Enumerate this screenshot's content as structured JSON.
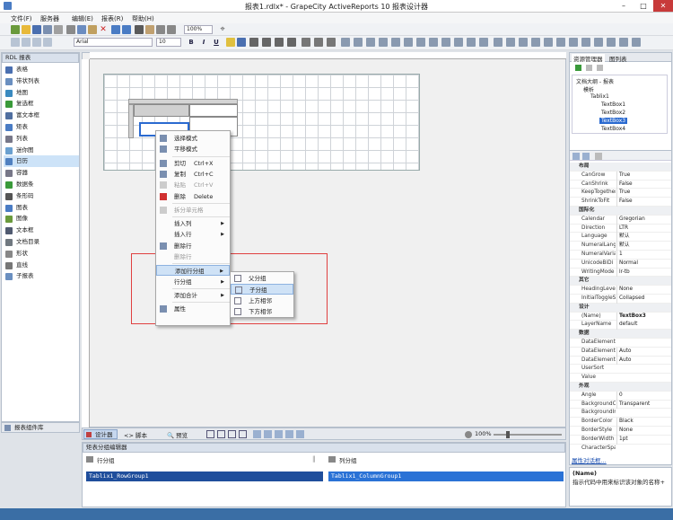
{
  "window": {
    "title": "报表1.rdlx* - GrapeCity ActiveReports 10 报表设计器",
    "minimize": "–",
    "maximize": "□",
    "close": "✕"
  },
  "menu": [
    "文件(F)",
    "服务器",
    "编辑(E)",
    "报表(R)",
    "帮助(H)"
  ],
  "toolbar": {
    "zoom": "100%",
    "font_name": "Arial",
    "font_size": "10",
    "bold": "B",
    "italic": "I",
    "underline": "U"
  },
  "toolbox": {
    "title": "RDL 报表",
    "items": [
      "表格",
      "带状列表",
      "地图",
      "复选框",
      "富文本框",
      "矩表",
      "列表",
      "迷你图",
      "日历",
      "容器",
      "数据条",
      "条形码",
      "图表",
      "图像",
      "文本框",
      "文档目录",
      "形状",
      "直线",
      "子报表"
    ],
    "selected_index": 8,
    "footer": "报表组件库"
  },
  "context_menu": {
    "items": [
      {
        "label": "选择模式",
        "key": "",
        "disabled": false,
        "submenu": false,
        "icon": "arrow-cursor-icon"
      },
      {
        "label": "平移模式",
        "key": "",
        "disabled": false,
        "submenu": false,
        "icon": "hand-icon"
      },
      {
        "sep": true
      },
      {
        "label": "剪切",
        "key": "Ctrl+X",
        "disabled": false,
        "submenu": false,
        "icon": "scissors-icon"
      },
      {
        "label": "复制",
        "key": "Ctrl+C",
        "disabled": false,
        "submenu": false,
        "icon": "copy-icon"
      },
      {
        "label": "粘贴",
        "key": "Ctrl+V",
        "disabled": true,
        "submenu": false,
        "icon": "paste-icon"
      },
      {
        "label": "删除",
        "key": "Delete",
        "disabled": false,
        "submenu": false,
        "icon": "delete-icon"
      },
      {
        "sep": true
      },
      {
        "label": "拆分单元格",
        "key": "",
        "disabled": true,
        "submenu": false,
        "icon": "split-cell-icon"
      },
      {
        "sep": true
      },
      {
        "label": "插入列",
        "key": "",
        "disabled": false,
        "submenu": true,
        "icon": ""
      },
      {
        "label": "插入行",
        "key": "",
        "disabled": false,
        "submenu": true,
        "icon": ""
      },
      {
        "label": "删除行",
        "key": "",
        "disabled": false,
        "submenu": false,
        "icon": "delete-row-icon"
      },
      {
        "label": "删除行",
        "key": "",
        "disabled": true,
        "submenu": false,
        "icon": ""
      },
      {
        "sep": true
      },
      {
        "label": "添加行分组",
        "key": "",
        "disabled": false,
        "submenu": true,
        "icon": "",
        "highlight": true
      },
      {
        "label": "行分组",
        "key": "",
        "disabled": false,
        "submenu": true,
        "icon": ""
      },
      {
        "sep": true
      },
      {
        "label": "添加合计",
        "key": "",
        "disabled": false,
        "submenu": true,
        "icon": ""
      },
      {
        "sep": true
      },
      {
        "label": "属性",
        "key": "",
        "disabled": false,
        "submenu": false,
        "icon": "properties-icon"
      }
    ]
  },
  "submenu": {
    "items": [
      "父分组",
      "子分组",
      "上方相邻",
      "下方相邻"
    ],
    "highlight_index": 1
  },
  "report_explorer": {
    "tabs": [
      "资源管理器",
      "图列表"
    ],
    "tree": [
      "文档大纲 - 报表",
      "模析",
      "Tablix1",
      "TextBox1",
      "TextBox2",
      "TextBox3",
      "TextBox4"
    ]
  },
  "properties": [
    {
      "cat": "布局"
    },
    {
      "n": "CanGrow",
      "v": "True"
    },
    {
      "n": "CanShrink",
      "v": "False"
    },
    {
      "n": "KeepTogether",
      "v": "True"
    },
    {
      "n": "ShrinkToFit",
      "v": "False"
    },
    {
      "cat": "国际化"
    },
    {
      "n": "Calendar",
      "v": "Gregorian"
    },
    {
      "n": "Direction",
      "v": "LTR"
    },
    {
      "n": "Language",
      "v": "默认"
    },
    {
      "n": "NumeralLanguage",
      "v": "默认"
    },
    {
      "n": "NumeralVariant",
      "v": "1"
    },
    {
      "n": "UnicodeBiDi",
      "v": "Normal"
    },
    {
      "n": "WritingMode",
      "v": "lr-tb"
    },
    {
      "cat": "其它"
    },
    {
      "n": "HeadingLevel",
      "v": "None"
    },
    {
      "n": "InitialToggleState",
      "v": "Collapsed"
    },
    {
      "cat": "设计"
    },
    {
      "n": "(Name)",
      "v": "TextBox3",
      "sel": true
    },
    {
      "n": "LayerName",
      "v": "default"
    },
    {
      "cat": "数据"
    },
    {
      "n": "DataElementName",
      "v": ""
    },
    {
      "n": "DataElementOutput",
      "v": "Auto"
    },
    {
      "n": "DataElementStyle",
      "v": "Auto"
    },
    {
      "n": "UserSort",
      "v": ""
    },
    {
      "n": "Value",
      "v": ""
    },
    {
      "cat": "外观"
    },
    {
      "n": "Angle",
      "v": "0"
    },
    {
      "n": "BackgroundColor",
      "v": "Transparent"
    },
    {
      "n": "BackgroundImage",
      "v": ""
    },
    {
      "n": "BorderColor",
      "v": "Black"
    },
    {
      "n": "BorderStyle",
      "v": "None"
    },
    {
      "n": "BorderWidth",
      "v": "1pt"
    },
    {
      "n": "CharacterSpacing",
      "v": ""
    }
  ],
  "properties_link": "属性对话框...",
  "properties_desc": {
    "title": "(Name)",
    "text": "指示代码中用来标识该对象的名称+"
  },
  "bottom_tabs": {
    "designer": "设计器",
    "script": "脚本",
    "preview": "预览",
    "zoom": "100%"
  },
  "grouping": {
    "title": "矩表分组编辑器",
    "row_header": "行分组",
    "col_header": "列分组",
    "row_group": "Tablix1_RowGroup1",
    "col_group": "Tablix1_ColumnGroup1"
  }
}
